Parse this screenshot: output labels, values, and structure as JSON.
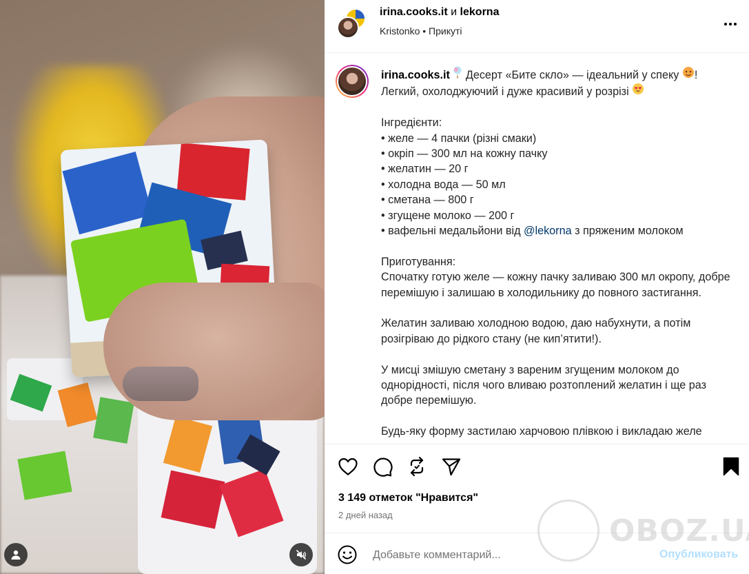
{
  "header": {
    "user1": "irina.cooks.it",
    "conjunction": "и",
    "user2": "lekorna",
    "sub_user": "Kristonko",
    "bullet": "•",
    "pinned": "Прикуті",
    "more_icon": "more-horizontal-icon"
  },
  "caption": {
    "username": "irina.cooks.it",
    "line1_text": " Десерт «Бите скло» — ідеальний у спеку ",
    "line1_tail": "!",
    "line2_text": "Легкий, охолоджуючий і дуже красивий у розрізі ",
    "ingredients_title": "Інгредієнти:",
    "ingredients": [
      "• желе — 4 пачки (різні смаки)",
      "• окріп — 300 мл на кожну пачку",
      "• желатин — 20 г",
      "• холодна вода — 50 мл",
      "• сметана — 800 г",
      "• згущене молоко — 200 г"
    ],
    "last_ingredient_before": "• вафельні медальйони від ",
    "last_ingredient_mention": "@lekorna",
    "last_ingredient_after": " з пряженим молоком",
    "steps_title": "Приготування:",
    "step1": "Спочатку готую желе — кожну пачку заливаю 300 мл окропу, добре перемішую і залишаю в холодильнику до повного застигання.",
    "step2": "Желатин заливаю холодною водою, даю набухнути, а потім розігріваю до рідкого стану (не кип’ятити!).",
    "step3": "У мисці змішую сметану з вареним згущеним молоком до однорідності, після чого вливаю розтоплений желатин і ще раз добре перемішую.",
    "step4": "Будь-яку форму застилаю харчовою плівкою і викладаю желе шарами."
  },
  "actions": {
    "likes": "3 149 отметок \"Нравится\"",
    "time": "2 дней назад",
    "comment_placeholder": "Добавьте комментарий...",
    "publish": "Опубликовать"
  },
  "watermark": {
    "text": "OBOZ.UA"
  },
  "colors": {
    "link": "#00376b",
    "publish_disabled": "#b2dffc",
    "muted": "#737373",
    "divider": "#efefef"
  }
}
